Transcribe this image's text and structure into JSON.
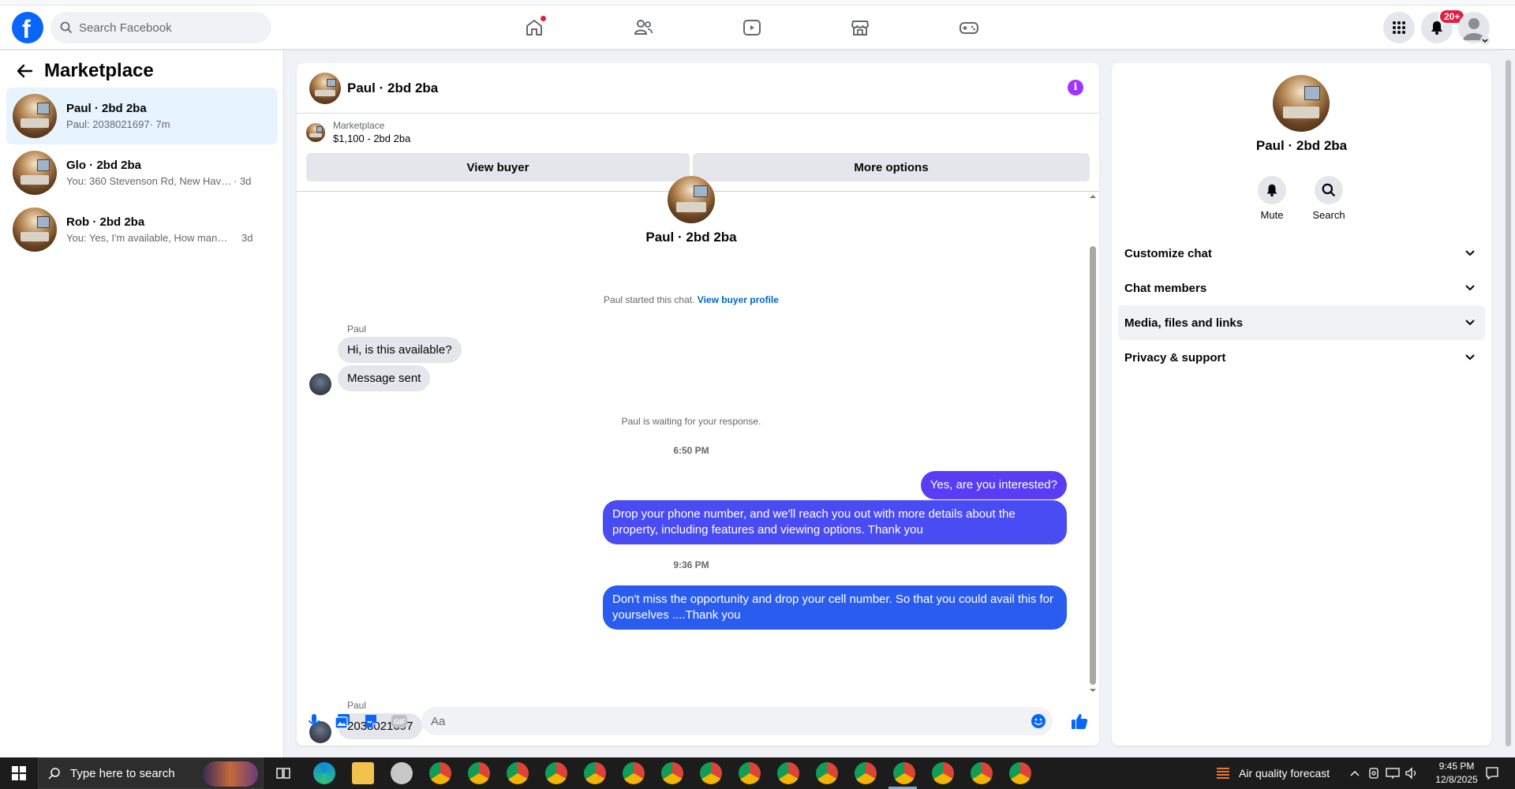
{
  "header": {
    "search_placeholder": "Search Facebook",
    "notifications_badge": "20+",
    "nav": [
      "home-icon",
      "friends-icon",
      "watch-icon",
      "marketplace-icon",
      "gaming-icon"
    ]
  },
  "sidebar": {
    "title": "Marketplace",
    "conversations": [
      {
        "name": "Paul · 2bd 2ba",
        "preview": "Paul: 2038021697",
        "time": "· 7m"
      },
      {
        "name": "Glo · 2bd 2ba",
        "preview": "You: 360 Stevenson Rd, New Haven, C...",
        "time": "· 3d"
      },
      {
        "name": "Rob · 2bd 2ba",
        "preview": "You: Yes, I'm available, How many me...",
        "time": "3d"
      }
    ]
  },
  "chat": {
    "title": "Paul · 2bd 2ba",
    "listing_label": "Marketplace",
    "listing_detail": "$1,100 - 2bd 2ba",
    "view_buyer": "View buyer",
    "more_options": "More options",
    "center_name": "Paul · 2bd 2ba",
    "started": "Paul started this chat.",
    "view_buyer_profile": "View buyer profile",
    "sender1": "Paul",
    "msg_in_1": "Hi, is this available?",
    "msg_in_2": "Message sent",
    "waiting": "Paul is waiting for your response.",
    "time1": "6:50 PM",
    "msg_out_1": "Yes, are you interested?",
    "msg_out_2": "Drop your phone number, and we'll reach you out with more details about the property, including features and viewing options.  Thank you",
    "time2": "9:36 PM",
    "msg_out_3": "Don't miss the opportunity and drop your cell number. So that you could  avail this for yourselves ....Thank you",
    "sender2": "Paul",
    "msg_in_3": "2038021697",
    "input_placeholder": "Aa",
    "colors": {
      "out_purple": "#5b3cf5",
      "out_blue": "#2b5cf0"
    }
  },
  "right_panel": {
    "name": "Paul · 2bd 2ba",
    "mute": "Mute",
    "search": "Search",
    "rows": [
      "Customize chat",
      "Chat members",
      "Media, files and links",
      "Privacy & support"
    ]
  },
  "taskbar": {
    "search_text": "Type here to search",
    "weather": "Air quality forecast",
    "time": "9:45 PM",
    "date": "12/8/2025"
  }
}
